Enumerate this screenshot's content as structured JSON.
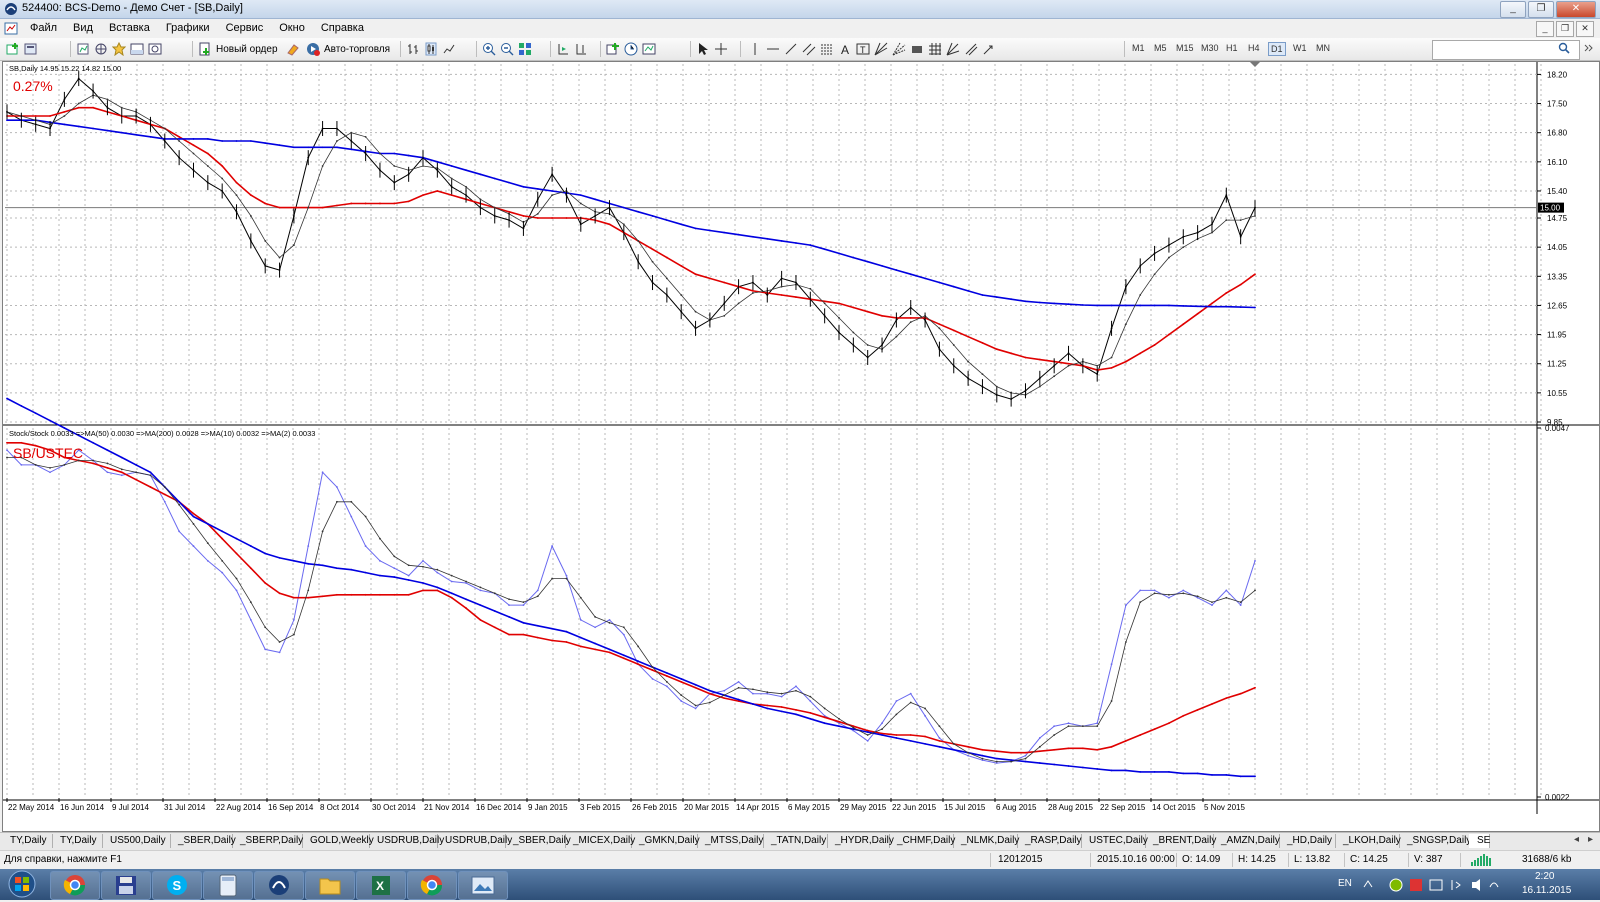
{
  "window": {
    "title": "524400: BCS-Demo - Демо Счет - [SB,Daily]",
    "buttons": [
      "_",
      "❐",
      "✕"
    ]
  },
  "menu": {
    "items": [
      "Файл",
      "Вид",
      "Вставка",
      "Графики",
      "Сервис",
      "Окно",
      "Справка"
    ],
    "mdi_buttons": [
      "_",
      "❐",
      "✕"
    ]
  },
  "toolbar": {
    "new_order": "Новый ордер",
    "auto_trading": "Авто-торговля",
    "timeframes": [
      "M1",
      "M5",
      "M15",
      "M30",
      "H1",
      "H4",
      "D1",
      "W1",
      "MN"
    ],
    "active_timeframe": "D1",
    "search_placeholder": ""
  },
  "chart_data": [
    {
      "type": "line",
      "name": "SB,Daily",
      "header": "SB,Daily  14.95 15.22 14.82 15.00",
      "change_label": "0.27%",
      "price_label": "15.00",
      "y_ticks": [
        "18.20",
        "17.50",
        "16.80",
        "16.10",
        "15.40",
        "14.75",
        "14.05",
        "13.35",
        "12.65",
        "11.95",
        "11.25",
        "10.55",
        "9.85"
      ],
      "ylim": [
        9.85,
        18.45
      ],
      "x_labels": [
        "22 May 2014",
        "16 Jun 2014",
        "9 Jul 2014",
        "31 Jul 2014",
        "22 Aug 2014",
        "16 Sep 2014",
        "8 Oct 2014",
        "30 Oct 2014",
        "21 Nov 2014",
        "16 Dec 2014",
        "9 Jan 2015",
        "3 Feb 2015",
        "26 Feb 2015",
        "20 Mar 2015",
        "14 Apr 2015",
        "6 May 2015",
        "29 May 2015",
        "22 Jun 2015",
        "15 Jul 2015",
        "6 Aug 2015",
        "28 Aug 2015",
        "22 Sep 2015",
        "14 Oct 2015",
        "5 Nov 2015"
      ],
      "series": [
        {
          "name": "price",
          "color": "#000000",
          "values": [
            17.3,
            17.1,
            17.0,
            16.9,
            17.6,
            18.1,
            17.8,
            17.4,
            17.2,
            17.2,
            17.0,
            16.6,
            16.2,
            15.9,
            15.6,
            15.4,
            14.9,
            14.2,
            13.6,
            13.5,
            14.8,
            16.2,
            16.9,
            16.9,
            16.6,
            16.3,
            15.9,
            15.6,
            15.8,
            16.2,
            15.9,
            15.5,
            15.3,
            15.0,
            14.8,
            14.7,
            14.5,
            15.2,
            15.8,
            15.3,
            14.6,
            14.8,
            15.0,
            14.4,
            13.7,
            13.2,
            12.9,
            12.5,
            12.1,
            12.3,
            12.7,
            13.1,
            13.2,
            12.9,
            13.3,
            13.2,
            12.8,
            12.4,
            12.0,
            11.7,
            11.4,
            11.7,
            12.3,
            12.6,
            12.3,
            11.6,
            11.2,
            10.9,
            10.7,
            10.5,
            10.4,
            10.6,
            10.9,
            11.2,
            11.5,
            11.2,
            11.0,
            12.1,
            13.1,
            13.6,
            13.9,
            14.1,
            14.3,
            14.4,
            14.6,
            15.3,
            14.3,
            15.0
          ]
        },
        {
          "name": "MA(50)",
          "color": "#e00000",
          "values": [
            17.2,
            17.2,
            17.2,
            17.2,
            17.3,
            17.4,
            17.4,
            17.3,
            17.2,
            17.1,
            17.0,
            16.9,
            16.7,
            16.5,
            16.3,
            16.0,
            15.6,
            15.3,
            15.1,
            15.0,
            15.0,
            15.0,
            15.0,
            15.05,
            15.1,
            15.1,
            15.1,
            15.1,
            15.15,
            15.3,
            15.4,
            15.3,
            15.2,
            15.1,
            15.0,
            14.9,
            14.8,
            14.75,
            14.75,
            14.75,
            14.75,
            14.7,
            14.6,
            14.4,
            14.2,
            14.0,
            13.8,
            13.6,
            13.4,
            13.3,
            13.2,
            13.1,
            13.0,
            12.95,
            12.9,
            12.85,
            12.8,
            12.75,
            12.7,
            12.6,
            12.5,
            12.4,
            12.35,
            12.35,
            12.35,
            12.2,
            12.05,
            11.9,
            11.75,
            11.6,
            11.5,
            11.4,
            11.35,
            11.3,
            11.25,
            11.2,
            11.1,
            11.15,
            11.3,
            11.5,
            11.7,
            11.95,
            12.2,
            12.45,
            12.7,
            12.95,
            13.15,
            13.4
          ]
        },
        {
          "name": "MA(200)",
          "color": "#0000e0",
          "values": [
            17.1,
            17.1,
            17.1,
            17.05,
            17.0,
            16.95,
            16.9,
            16.85,
            16.8,
            16.75,
            16.7,
            16.65,
            16.65,
            16.65,
            16.65,
            16.6,
            16.6,
            16.6,
            16.55,
            16.5,
            16.45,
            16.45,
            16.45,
            16.45,
            16.4,
            16.35,
            16.3,
            16.3,
            16.25,
            16.2,
            16.1,
            16.0,
            15.9,
            15.8,
            15.7,
            15.6,
            15.5,
            15.45,
            15.4,
            15.35,
            15.3,
            15.2,
            15.1,
            15.0,
            14.9,
            14.8,
            14.7,
            14.6,
            14.5,
            14.45,
            14.4,
            14.35,
            14.3,
            14.25,
            14.2,
            14.15,
            14.1,
            14.0,
            13.9,
            13.8,
            13.7,
            13.6,
            13.5,
            13.4,
            13.3,
            13.2,
            13.1,
            13.0,
            12.9,
            12.85,
            12.8,
            12.75,
            12.72,
            12.7,
            12.68,
            12.66,
            12.65,
            12.65,
            12.65,
            12.65,
            12.65,
            12.65,
            12.64,
            12.63,
            12.62,
            12.62,
            12.61,
            12.6
          ]
        },
        {
          "name": "MA(10)",
          "color": "#333333",
          "values": [
            17.3,
            17.2,
            17.1,
            17.0,
            17.2,
            17.5,
            17.7,
            17.6,
            17.4,
            17.3,
            17.1,
            16.9,
            16.6,
            16.3,
            16.0,
            15.7,
            15.3,
            14.8,
            14.2,
            13.8,
            14.1,
            15.0,
            16.0,
            16.6,
            16.8,
            16.7,
            16.3,
            16.0,
            15.9,
            16.0,
            15.95,
            15.7,
            15.5,
            15.2,
            15.0,
            14.85,
            14.65,
            14.85,
            15.3,
            15.4,
            15.1,
            14.9,
            14.85,
            14.6,
            14.2,
            13.7,
            13.3,
            12.9,
            12.5,
            12.3,
            12.4,
            12.7,
            12.95,
            13.0,
            13.1,
            13.15,
            13.05,
            12.7,
            12.35,
            12.0,
            11.7,
            11.6,
            11.9,
            12.25,
            12.4,
            12.1,
            11.7,
            11.3,
            11.0,
            10.7,
            10.55,
            10.5,
            10.7,
            10.95,
            11.2,
            11.3,
            11.2,
            11.4,
            12.2,
            12.9,
            13.4,
            13.8,
            14.05,
            14.25,
            14.4,
            14.7,
            14.7,
            14.8
          ]
        }
      ]
    },
    {
      "type": "line",
      "name": "SB/USTEC",
      "header": "Stock/Stock 0.0033 =>MA(50) 0.0030 =>MA(200) 0.0028 =>MA(10) 0.0032 =>MA(2) 0.0033",
      "pair_label": "SB/USTEC",
      "y_ticks": [
        "0.0047",
        "0.0022"
      ],
      "ylim": [
        0.0022,
        0.0047
      ],
      "series": [
        {
          "name": "ratio",
          "color": "#6a6af0",
          "values": [
            0.00455,
            0.00445,
            0.00445,
            0.0044,
            0.00445,
            0.00455,
            0.00448,
            0.0044,
            0.00438,
            0.0044,
            0.00438,
            0.0042,
            0.004,
            0.0039,
            0.0038,
            0.00372,
            0.0036,
            0.0034,
            0.0032,
            0.00318,
            0.0034,
            0.0039,
            0.0044,
            0.0043,
            0.0041,
            0.0039,
            0.0038,
            0.00375,
            0.0037,
            0.0038,
            0.00372,
            0.00366,
            0.00365,
            0.0036,
            0.00358,
            0.0035,
            0.0035,
            0.0036,
            0.0039,
            0.0037,
            0.0034,
            0.00335,
            0.0034,
            0.0033,
            0.0031,
            0.003,
            0.00295,
            0.00285,
            0.0028,
            0.0029,
            0.00292,
            0.00298,
            0.0029,
            0.0029,
            0.00288,
            0.00295,
            0.00285,
            0.00275,
            0.0027,
            0.00265,
            0.00258,
            0.0027,
            0.00285,
            0.0029,
            0.00275,
            0.0026,
            0.00252,
            0.00248,
            0.00245,
            0.00243,
            0.00244,
            0.00248,
            0.0026,
            0.00268,
            0.0027,
            0.00268,
            0.0027,
            0.0031,
            0.0035,
            0.0036,
            0.0036,
            0.00355,
            0.0036,
            0.00355,
            0.0035,
            0.0036,
            0.0035,
            0.0038
          ]
        },
        {
          "name": "MA(50)",
          "color": "#e00000",
          "values": [
            0.0046,
            0.0046,
            0.00458,
            0.00455,
            0.0045,
            0.00448,
            0.00446,
            0.00443,
            0.0044,
            0.00435,
            0.0043,
            0.00425,
            0.0042,
            0.00412,
            0.00405,
            0.00395,
            0.00385,
            0.00375,
            0.00365,
            0.00358,
            0.00355,
            0.00355,
            0.00356,
            0.00357,
            0.00357,
            0.00357,
            0.00357,
            0.00357,
            0.00357,
            0.0036,
            0.0036,
            0.00355,
            0.00348,
            0.0034,
            0.00335,
            0.0033,
            0.0033,
            0.00328,
            0.00326,
            0.00325,
            0.00322,
            0.0032,
            0.00318,
            0.00314,
            0.0031,
            0.00306,
            0.00302,
            0.00298,
            0.00294,
            0.0029,
            0.00287,
            0.00285,
            0.00283,
            0.00282,
            0.00281,
            0.00279,
            0.00277,
            0.00274,
            0.00271,
            0.00268,
            0.00265,
            0.00263,
            0.00262,
            0.00262,
            0.00261,
            0.00258,
            0.00256,
            0.00254,
            0.00252,
            0.00251,
            0.0025,
            0.0025,
            0.00251,
            0.00252,
            0.00253,
            0.00253,
            0.00252,
            0.00254,
            0.00258,
            0.00262,
            0.00266,
            0.0027,
            0.00275,
            0.00279,
            0.00283,
            0.00287,
            0.0029,
            0.00294
          ]
        },
        {
          "name": "MA(200)",
          "color": "#0000e0",
          "values": [
            0.0049,
            0.00485,
            0.0048,
            0.00475,
            0.0047,
            0.00465,
            0.0046,
            0.00455,
            0.0045,
            0.00445,
            0.0044,
            0.0043,
            0.0042,
            0.0041,
            0.00405,
            0.004,
            0.00395,
            0.0039,
            0.00385,
            0.00382,
            0.0038,
            0.00378,
            0.00377,
            0.00375,
            0.00374,
            0.00372,
            0.0037,
            0.00369,
            0.00367,
            0.00365,
            0.00362,
            0.00358,
            0.00354,
            0.0035,
            0.00346,
            0.00342,
            0.00338,
            0.00336,
            0.00334,
            0.00332,
            0.00328,
            0.00324,
            0.0032,
            0.00316,
            0.00312,
            0.00308,
            0.00304,
            0.003,
            0.00296,
            0.00292,
            0.00289,
            0.00286,
            0.00283,
            0.0028,
            0.00278,
            0.00276,
            0.00273,
            0.0027,
            0.00268,
            0.00266,
            0.00264,
            0.00262,
            0.0026,
            0.00258,
            0.00256,
            0.00254,
            0.00252,
            0.0025,
            0.00248,
            0.00246,
            0.00245,
            0.00244,
            0.00243,
            0.00242,
            0.00241,
            0.0024,
            0.00239,
            0.00238,
            0.00238,
            0.00237,
            0.00237,
            0.00237,
            0.00236,
            0.00236,
            0.00235,
            0.00235,
            0.00234,
            0.00234
          ]
        },
        {
          "name": "MA(10)",
          "color": "#333333",
          "values": [
            0.0045,
            0.0045,
            0.00445,
            0.00443,
            0.00445,
            0.00448,
            0.00448,
            0.00446,
            0.00442,
            0.0044,
            0.00438,
            0.0043,
            0.00418,
            0.00405,
            0.00392,
            0.0038,
            0.00368,
            0.00352,
            0.00335,
            0.00325,
            0.0033,
            0.0036,
            0.004,
            0.0042,
            0.0042,
            0.0041,
            0.00395,
            0.00383,
            0.00377,
            0.00376,
            0.00374,
            0.0037,
            0.00366,
            0.00362,
            0.00358,
            0.00354,
            0.00352,
            0.00356,
            0.00368,
            0.00368,
            0.00355,
            0.00342,
            0.00338,
            0.00335,
            0.00322,
            0.00308,
            0.00298,
            0.00289,
            0.00282,
            0.00284,
            0.00289,
            0.00294,
            0.00293,
            0.00291,
            0.0029,
            0.00292,
            0.00288,
            0.0028,
            0.00273,
            0.00267,
            0.00262,
            0.00266,
            0.00276,
            0.00284,
            0.0028,
            0.00268,
            0.00256,
            0.0025,
            0.00246,
            0.00244,
            0.00244,
            0.00246,
            0.00254,
            0.00262,
            0.00268,
            0.00268,
            0.00268,
            0.00285,
            0.00325,
            0.00352,
            0.00358,
            0.00357,
            0.00358,
            0.00356,
            0.00352,
            0.00355,
            0.00352,
            0.0036
          ]
        }
      ]
    }
  ],
  "symbol_tabs": [
    "TY,Daily",
    "TY,Daily",
    "US500,Daily",
    "_SBER,Daily",
    "_SBERP,Daily",
    "GOLD,Weekly",
    "USDRUB,Daily",
    "USDRUB,Daily",
    "_SBER,Daily",
    "_MICEX,Daily",
    "_GMKN,Daily",
    "_MTSS,Daily",
    "_TATN,Daily",
    "_HYDR,Daily",
    "_CHMF,Daily",
    "_NLMK,Daily",
    "_RASP,Daily",
    "USTEC,Daily",
    "_BRENT,Daily",
    "_AMZN,Daily",
    "_HD,Daily",
    "_LKOH,Daily",
    "_SNGSP,Daily",
    "SE"
  ],
  "active_tab_index": 23,
  "status": {
    "help": "Для справки, нажмите F1",
    "profile": "12012015",
    "datetime": "2015.10.16 00:00",
    "open": "O: 14.09",
    "high": "H: 14.25",
    "low": "L: 13.82",
    "close": "C: 14.25",
    "volume": "V: 387",
    "traffic": "31688/6 kb"
  },
  "taskbar": {
    "lang": "EN",
    "time": "2:20",
    "date": "16.11.2015"
  }
}
